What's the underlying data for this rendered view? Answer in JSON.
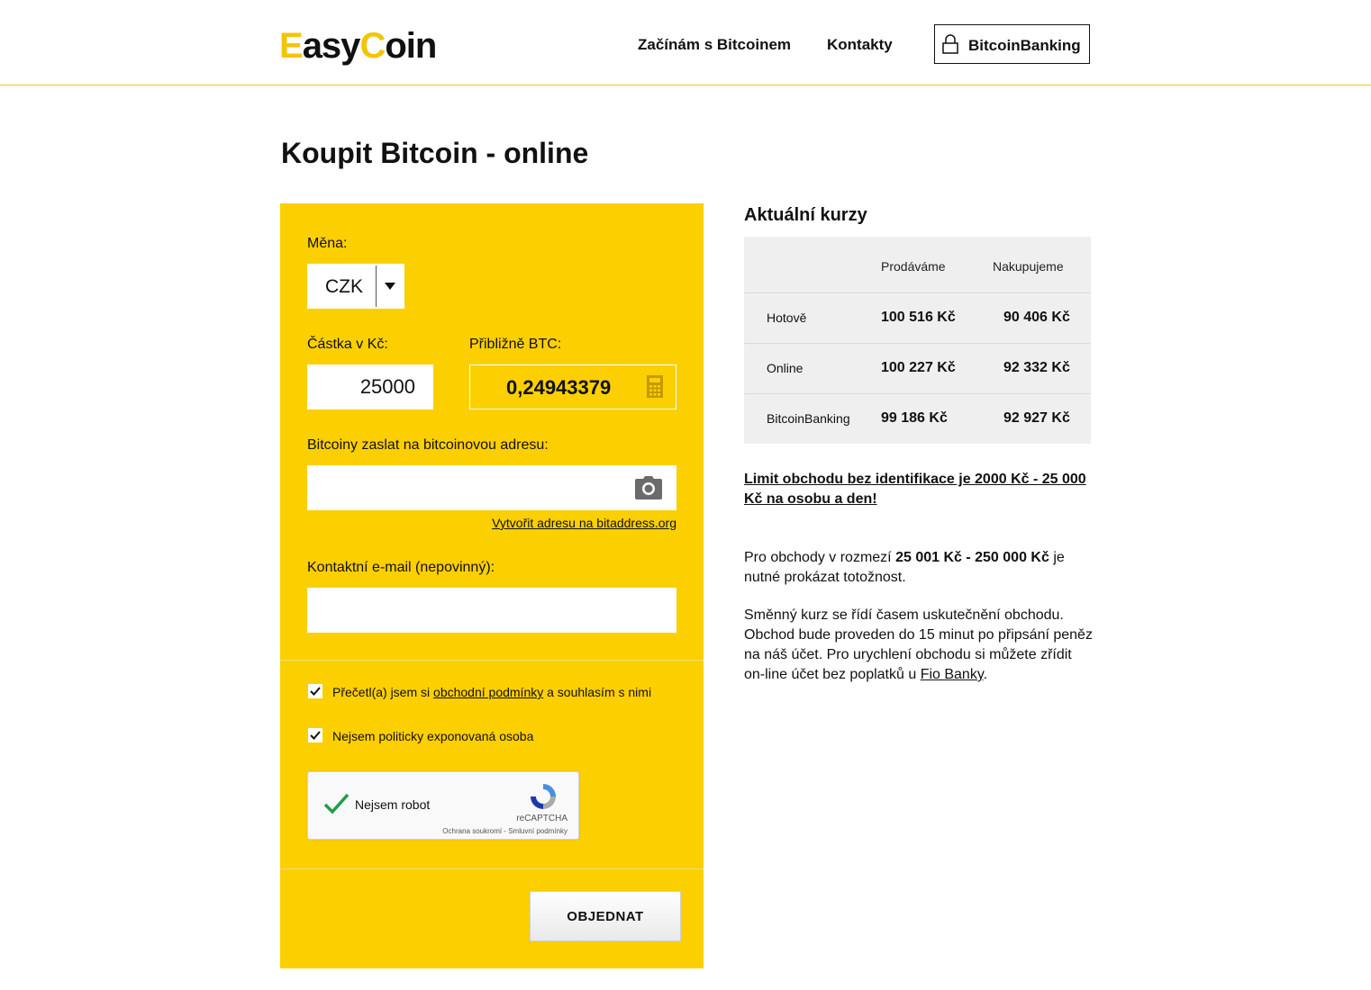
{
  "header": {
    "logo_part1": "Easy",
    "logo_part2": "Coin",
    "nav": {
      "start": "Začínám s Bitcoinem",
      "contacts": "Kontakty",
      "banking": "BitcoinBanking"
    }
  },
  "page_title": "Koupit Bitcoin - online",
  "form": {
    "currency_label": "Měna:",
    "currency_value": "CZK",
    "amount_label": "Částka v Kč:",
    "amount_value": "25000",
    "btc_label": "Přibližně BTC:",
    "btc_value": "0,24943379",
    "address_label": "Bitcoiny zaslat na bitcoinovou adresu:",
    "address_value": "",
    "create_address_link": "Vytvořit adresu na bitaddress.org",
    "email_label": "Kontaktní e-mail (nepovinný):",
    "email_value": "",
    "terms_prefix": "Přečetl(a) jsem si ",
    "terms_link": "obchodní podmínky",
    "terms_suffix": " a souhlasím s nimi",
    "terms_checked": true,
    "pep_label": "Nejsem politicky exponovaná osoba",
    "pep_checked": true,
    "captcha_label": "Nejsem robot",
    "captcha_brand": "reCAPTCHA",
    "captcha_terms": "Ochrana soukromí - Smluvní podmínky",
    "order_button": "OBJEDNAT"
  },
  "rates": {
    "title": "Aktuální kurzy",
    "col_sell": "Prodáváme",
    "col_buy": "Nakupujeme",
    "rows": [
      {
        "name": "Hotově",
        "sell": "100 516 Kč",
        "buy": "90 406 Kč"
      },
      {
        "name": "Online",
        "sell": "100 227 Kč",
        "buy": "92 332 Kč"
      },
      {
        "name": "BitcoinBanking",
        "sell": "99 186 Kč",
        "buy": "92 927 Kč"
      }
    ]
  },
  "info": {
    "limit_text": "Limit obchodu bez identifikace je 2000 Kč - 25 000 Kč na osobu a den!",
    "id_prefix": "Pro obchody v rozmezí ",
    "id_range": "25 001 Kč - 250 000 Kč",
    "id_suffix": " je nutné prokázat totožnost.",
    "rate_text": "Směnný kurz se řídí časem uskutečnění obchodu. Obchod bude proveden do 15 minut po připsání peněz na náš účet. Pro urychlení obchodu si můžete zřídit on-line účet bez poplatků u ",
    "fio_link": "Fio Banky",
    "rate_end": "."
  },
  "colors": {
    "brand_yellow": "#fccf00",
    "text": "#111111",
    "table_bg": "#efefef"
  },
  "icons": {
    "lock": "lock-icon",
    "caret": "chevron-down-icon",
    "calculator": "calculator-icon",
    "camera": "camera-icon",
    "checkbox": "checkmark-icon",
    "recaptcha": "recaptcha-logo-icon"
  }
}
